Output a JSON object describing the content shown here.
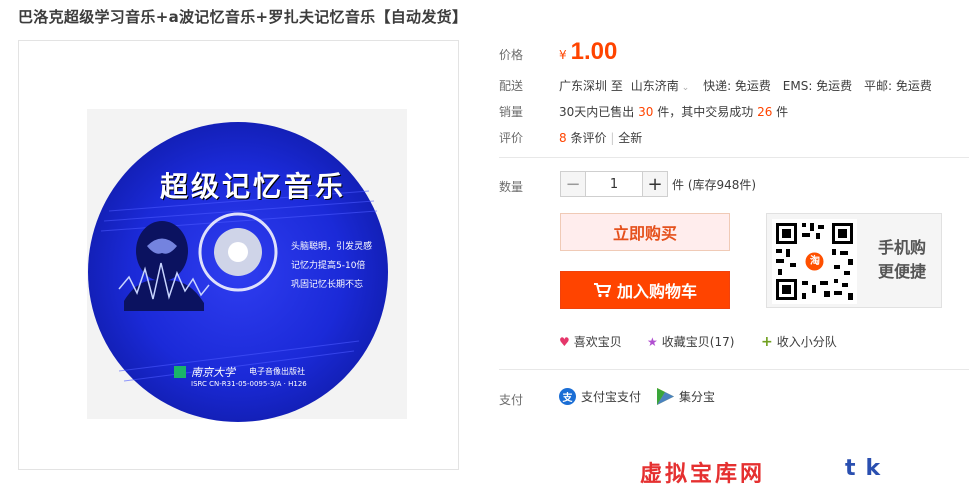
{
  "title": "巴洛克超级学习音乐+a波记忆音乐+罗扎夫记忆音乐【自动发货】",
  "product_image": {
    "disc_title": "超级记忆音乐",
    "slogans": [
      "头脑聪明，引发灵感",
      "记忆力提高5-10倍",
      "巩固记忆长期不忘"
    ],
    "publisher": "南京大学",
    "publisher_sub": "电子音像出版社",
    "isrc": "ISRC CN-R31-05-0095-3/A · H126"
  },
  "price": {
    "label": "价格",
    "currency": "¥",
    "value": "1.00"
  },
  "shipping": {
    "label": "配送",
    "from": "广东深圳",
    "to_word": "至",
    "to": "山东济南",
    "express": "快递: 免运费",
    "ems": "EMS: 免运费",
    "post": "平邮: 免运费"
  },
  "sales": {
    "label": "销量",
    "prefix": "30天内已售出",
    "sold": "30",
    "mid": "件，其中交易成功",
    "success": "26",
    "suffix": "件"
  },
  "reviews": {
    "label": "评价",
    "count": "8",
    "count_suffix": "条评价",
    "sep": "|",
    "tag": "全新"
  },
  "quantity": {
    "label": "数量",
    "minus": "−",
    "value": "1",
    "plus": "+",
    "stock": "件 (库存948件)"
  },
  "buttons": {
    "buy_now": "立即购买",
    "add_cart": "加入购物车"
  },
  "mobile": {
    "logo": "淘",
    "line1": "手机购",
    "line2": "更便捷"
  },
  "favorites": {
    "like": "喜欢宝贝",
    "collect": "收藏宝贝(17)",
    "team": "收入小分队"
  },
  "payment": {
    "label": "支付",
    "alipay_icon": "支",
    "alipay": "支付宝支付",
    "jifen": "集分宝"
  },
  "watermark": {
    "text1": "虚拟宝库网",
    "text2": "tk"
  },
  "colors": {
    "accent": "#ff4400",
    "buy_bg": "#ffeded",
    "disc_blue": "#1a2bd8"
  }
}
